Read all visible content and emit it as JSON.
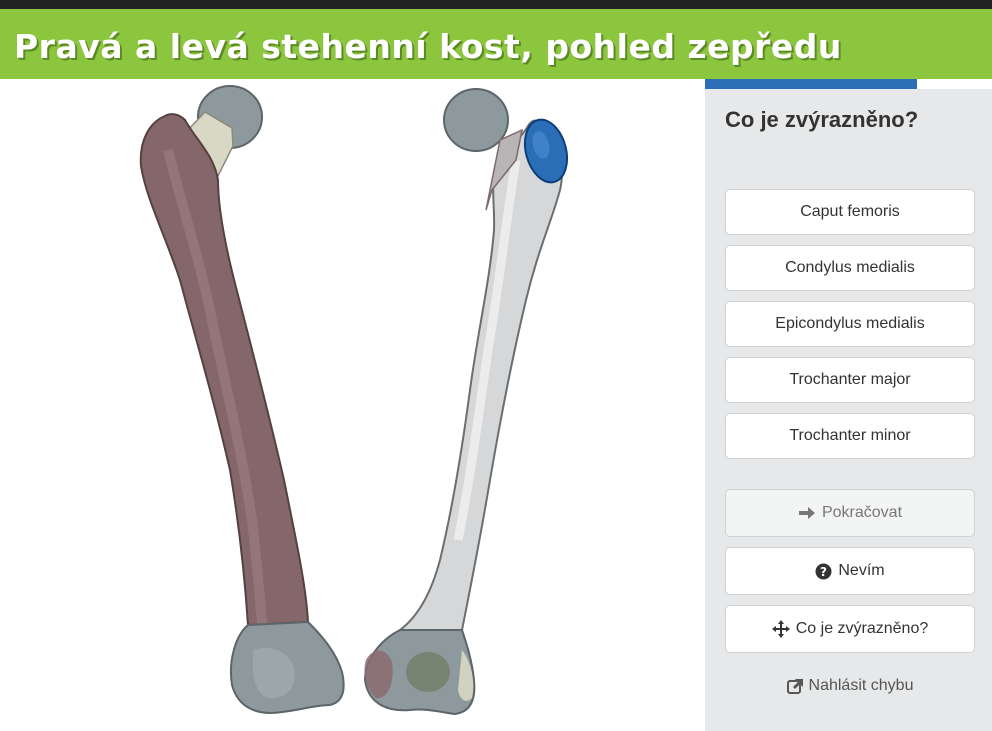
{
  "header": {
    "title": "Pravá a levá stehenní kost, pohled zepředu"
  },
  "quiz": {
    "progress_fraction": 0.74,
    "question": "Co je zvýrazněno?",
    "options": [
      "Caput femoris",
      "Condylus medialis",
      "Epicondylus medialis",
      "Trochanter major",
      "Trochanter minor"
    ],
    "actions": {
      "continue": "Pokračovat",
      "dont_know": "Nevím",
      "what_highlighted": "Co je zvýrazněno?",
      "report": "Nahlásit chybu"
    }
  },
  "colors": {
    "header": "#8cc63f",
    "highlight": "#2a6eb8",
    "right_femur": "#8a6b6f",
    "left_femur": "#d8d9da"
  },
  "icons": {
    "continue": "arrow-right-icon",
    "dont_know": "question-circle-icon",
    "what_highlighted": "crosshair-arrows-icon",
    "report": "external-link-icon"
  }
}
